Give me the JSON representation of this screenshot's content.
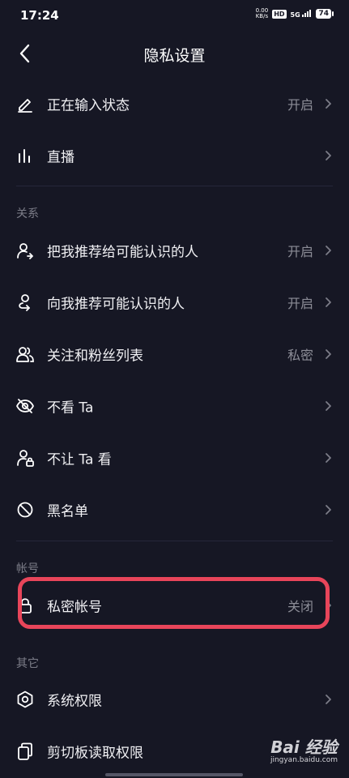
{
  "status_bar": {
    "time": "17:24",
    "net_speed_value": "0.00",
    "net_speed_unit": "KB/s",
    "hd_label": "HD",
    "signal_label": "5G",
    "battery_level": "74"
  },
  "header": {
    "title": "隐私设置",
    "back_icon": "chevron-left-icon"
  },
  "sections": {
    "relations": "关系",
    "account": "帐号",
    "other": "其它"
  },
  "rows": [
    {
      "label": "正在输入状态",
      "value": "开启",
      "icon": "pencil-icon"
    },
    {
      "label": "直播",
      "value": "",
      "icon": "live-bars-icon"
    },
    {
      "label": "把我推荐给可能认识的人",
      "value": "开启",
      "icon": "share-person-icon"
    },
    {
      "label": "向我推荐可能认识的人",
      "value": "开启",
      "icon": "recommend-person-icon"
    },
    {
      "label": "关注和粉丝列表",
      "value": "私密",
      "icon": "people-icon"
    },
    {
      "label": "不看 Ta",
      "value": "",
      "icon": "eye-off-icon"
    },
    {
      "label": "不让 Ta 看",
      "value": "",
      "icon": "person-lock-icon"
    },
    {
      "label": "黑名单",
      "value": "",
      "icon": "block-icon"
    },
    {
      "label": "私密帐号",
      "value": "关闭",
      "icon": "lock-icon"
    },
    {
      "label": "系统权限",
      "value": "",
      "icon": "hexagon-settings-icon"
    },
    {
      "label": "剪切板读取权限",
      "value": "",
      "icon": "clipboard-icon"
    }
  ],
  "watermark": {
    "logo": "Bai 经验",
    "url": "jingyan.baidu.com"
  },
  "colors": {
    "background": "#161724",
    "highlight": "#E8455A",
    "secondary_text": "#8C8D97"
  }
}
